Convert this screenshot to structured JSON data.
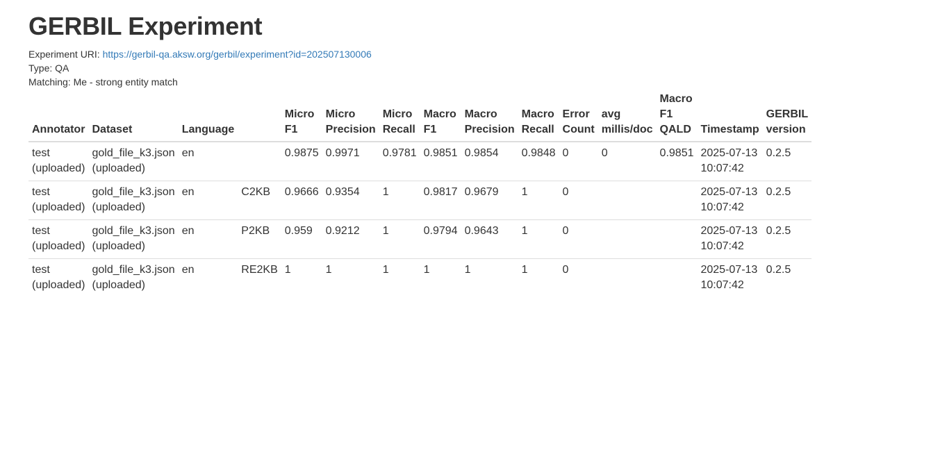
{
  "page": {
    "title": "GERBIL Experiment",
    "experiment_uri_label": "Experiment URI: ",
    "experiment_uri": "https://gerbil-qa.aksw.org/gerbil/experiment?id=202507130006",
    "type_line": "Type: QA",
    "matching_line": "Matching: Me - strong entity match",
    "link_color": "#337ab7"
  },
  "table": {
    "headers": [
      [
        "Annotator"
      ],
      [
        "Dataset"
      ],
      [
        "Language"
      ],
      [
        ""
      ],
      [
        "Micro",
        "F1"
      ],
      [
        "Micro",
        "Precision"
      ],
      [
        "Micro",
        "Recall"
      ],
      [
        "Macro",
        "F1"
      ],
      [
        "Macro",
        "Precision"
      ],
      [
        "Macro",
        "Recall"
      ],
      [
        "Error",
        "Count"
      ],
      [
        "avg",
        "millis/doc"
      ],
      [
        "Macro",
        "F1",
        "QALD"
      ],
      [
        "Timestamp"
      ],
      [
        "GERBIL",
        "version"
      ]
    ],
    "rows": [
      [
        [
          "test",
          "(uploaded)"
        ],
        [
          "gold_file_k3.json",
          "(uploaded)"
        ],
        [
          "en"
        ],
        [
          ""
        ],
        [
          "0.9875"
        ],
        [
          "0.9971"
        ],
        [
          "0.9781"
        ],
        [
          "0.9851"
        ],
        [
          "0.9854"
        ],
        [
          "0.9848"
        ],
        [
          "0"
        ],
        [
          "0"
        ],
        [
          "0.9851"
        ],
        [
          "2025-07-13",
          "10:07:42"
        ],
        [
          "0.2.5"
        ]
      ],
      [
        [
          "test",
          "(uploaded)"
        ],
        [
          "gold_file_k3.json",
          "(uploaded)"
        ],
        [
          "en"
        ],
        [
          "C2KB"
        ],
        [
          "0.9666"
        ],
        [
          "0.9354"
        ],
        [
          "1"
        ],
        [
          "0.9817"
        ],
        [
          "0.9679"
        ],
        [
          "1"
        ],
        [
          "0"
        ],
        [
          ""
        ],
        [
          ""
        ],
        [
          "2025-07-13",
          "10:07:42"
        ],
        [
          "0.2.5"
        ]
      ],
      [
        [
          "test",
          "(uploaded)"
        ],
        [
          "gold_file_k3.json",
          "(uploaded)"
        ],
        [
          "en"
        ],
        [
          "P2KB"
        ],
        [
          "0.959"
        ],
        [
          "0.9212"
        ],
        [
          "1"
        ],
        [
          "0.9794"
        ],
        [
          "0.9643"
        ],
        [
          "1"
        ],
        [
          "0"
        ],
        [
          ""
        ],
        [
          ""
        ],
        [
          "2025-07-13",
          "10:07:42"
        ],
        [
          "0.2.5"
        ]
      ],
      [
        [
          "test",
          "(uploaded)"
        ],
        [
          "gold_file_k3.json",
          "(uploaded)"
        ],
        [
          "en"
        ],
        [
          "RE2KB"
        ],
        [
          "1"
        ],
        [
          "1"
        ],
        [
          "1"
        ],
        [
          "1"
        ],
        [
          "1"
        ],
        [
          "1"
        ],
        [
          "0"
        ],
        [
          ""
        ],
        [
          ""
        ],
        [
          "2025-07-13",
          "10:07:42"
        ],
        [
          "0.2.5"
        ]
      ]
    ]
  }
}
